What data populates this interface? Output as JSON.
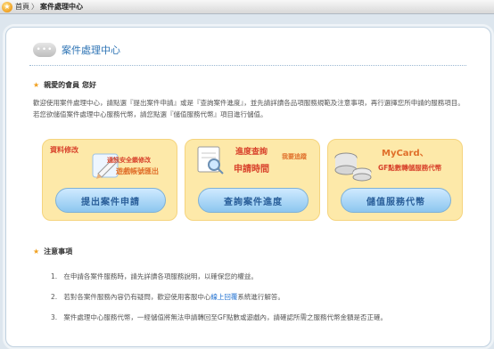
{
  "breadcrumb": {
    "home": "首頁",
    "separator": "〉",
    "current": "案件處理中心"
  },
  "page": {
    "title": "案件處理中心",
    "greeting": "親愛的會員 您好",
    "intro": "歡迎使用案件處理中心，請點選『提出案件申請』或是『查詢案件進度』，並先請詳讀各品項服務規範及注意事項，再行選擇您所申請的服務項目。若您欲儲值案件處理中心服務代幣，請您點選『儲值服務代幣』項目進行儲值。"
  },
  "cards": [
    {
      "button": "提出案件申請",
      "tags": [
        "資料修改",
        "通訊安全鎖修改",
        "遊戲帳號匯出"
      ]
    },
    {
      "button": "查詢案件進度",
      "tags": [
        "進度查詢",
        "申請時間",
        "我要追蹤"
      ]
    },
    {
      "button": "儲值服務代幣",
      "tags": [
        "MyCard、",
        "GF點數轉儲服務代幣"
      ]
    }
  ],
  "notes": {
    "title": "注意事項",
    "items": [
      {
        "num": "1.",
        "text": "在申請各案件服務時，請先詳讀各項服務說明，以確保您的權益。"
      },
      {
        "num": "2.",
        "pre": "若對各案件服務內容仍有疑問，歡迎使用客服中心",
        "link": "線上回覆",
        "post": "系統進行解答。"
      },
      {
        "num": "3.",
        "text": "案件處理中心服務代幣，一經儲值將無法申請轉回至GF點數或遊戲內，請確認所需之服務代幣金額是否正確。"
      }
    ]
  },
  "colors": {
    "accent": "#2e74b5",
    "card_bg": "#fde9a9",
    "button_blue": "#8cc6ef",
    "tag_red": "#d8432c"
  }
}
